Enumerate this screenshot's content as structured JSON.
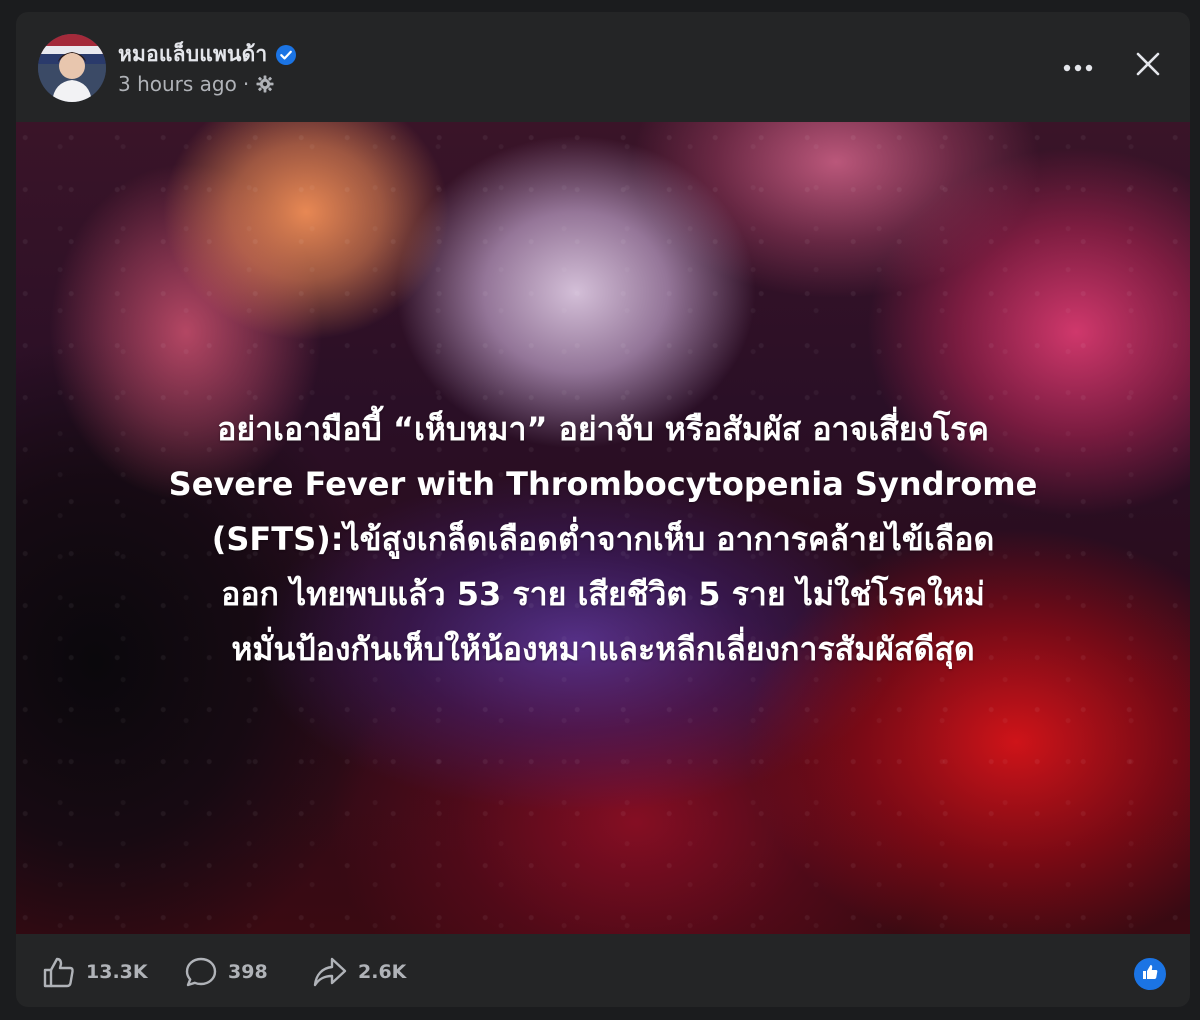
{
  "post": {
    "author": "หมอแล็บแพนด้า",
    "timestamp": "3 hours ago",
    "separator": "·"
  },
  "header_actions": {
    "more_icon": "more-horizontal-icon",
    "close_icon": "close-icon"
  },
  "image": {
    "lines": [
      "อย่าเอามือบี้ “เห็บหมา” อย่าจับ หรือสัมผัส อาจเสี่ยงโรค",
      "Severe Fever with Thrombocytopenia Syndrome",
      "(SFTS):ไข้สูงเกล็ดเลือดต่ำจากเห็บ อาการคล้ายไข้เลือด",
      "ออก ไทยพบแล้ว 53 ราย เสียชีวิต 5 ราย ไม่ใช่โรคใหม่",
      "หมั่นป้องกันเห็บให้น้องหมาและหลีกเลี่ยงการสัมผัสดีสุด"
    ]
  },
  "footer": {
    "likes": "13.3K",
    "comments": "398",
    "shares": "2.6K"
  },
  "colors": {
    "card_bg": "#242526",
    "text_primary": "#e4e6eb",
    "text_secondary": "#b0b3b8",
    "accent": "#1b74e4"
  }
}
